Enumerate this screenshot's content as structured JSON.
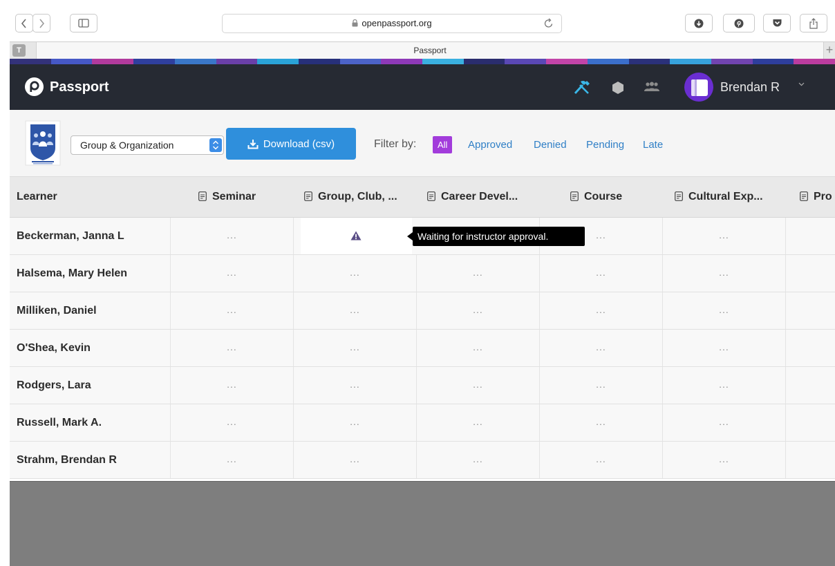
{
  "browser": {
    "url": "openpassport.org",
    "tab_title": "Passport",
    "tab_favicon_letter": "T",
    "new_tab_symbol": "+"
  },
  "header": {
    "brand": "Passport",
    "user_name": "Brendan R",
    "colors": {
      "bar": "#262a33",
      "avatar": "#6a2ed1",
      "tools_icon": "#3ab7e8"
    }
  },
  "filterbar": {
    "selected_group": "Group & Organization",
    "download_label": "Download (csv)",
    "filter_label": "Filter by:",
    "filters": [
      "All",
      "Approved",
      "Denied",
      "Pending",
      "Late"
    ],
    "active_filter": "All",
    "colors": {
      "download": "#2f8fdc",
      "active_chip": "#a23cdb",
      "link": "#2f7fc6"
    }
  },
  "table": {
    "learner_header": "Learner",
    "columns": [
      "Seminar",
      "Group, Club, ...",
      "Career Devel...",
      "Course",
      "Cultural Exp...",
      "Pro"
    ],
    "rows": [
      {
        "name": "Beckerman, Janna L",
        "cells": [
          "...",
          "warning",
          "",
          "...",
          "...",
          ""
        ]
      },
      {
        "name": "Halsema, Mary Helen",
        "cells": [
          "...",
          "...",
          "...",
          "...",
          "...",
          ""
        ]
      },
      {
        "name": "Milliken, Daniel",
        "cells": [
          "...",
          "...",
          "...",
          "...",
          "...",
          ""
        ]
      },
      {
        "name": "O'Shea, Kevin",
        "cells": [
          "...",
          "...",
          "...",
          "...",
          "...",
          ""
        ]
      },
      {
        "name": "Rodgers, Lara",
        "cells": [
          "...",
          "...",
          "...",
          "...",
          "...",
          ""
        ]
      },
      {
        "name": "Russell, Mark A.",
        "cells": [
          "...",
          "...",
          "...",
          "...",
          "...",
          ""
        ]
      },
      {
        "name": "Strahm, Brendan R",
        "cells": [
          "...",
          "...",
          "...",
          "...",
          "...",
          ""
        ]
      }
    ],
    "tooltip": "Waiting for instructor approval."
  },
  "icons": {
    "back": "chevron-left-icon",
    "forward": "chevron-right-icon",
    "sidebar": "sidebar-icon",
    "lock": "lock-icon",
    "reload": "reload-icon",
    "download": "download-icon",
    "pinterest": "pinterest-icon",
    "pocket": "pocket-icon",
    "share": "share-icon",
    "logo": "passport-logo-icon",
    "tools": "tools-icon",
    "hexagon": "hexagon-icon",
    "group": "group-icon",
    "caret": "chevron-down-icon",
    "column": "document-icon",
    "warning": "warning-icon"
  }
}
